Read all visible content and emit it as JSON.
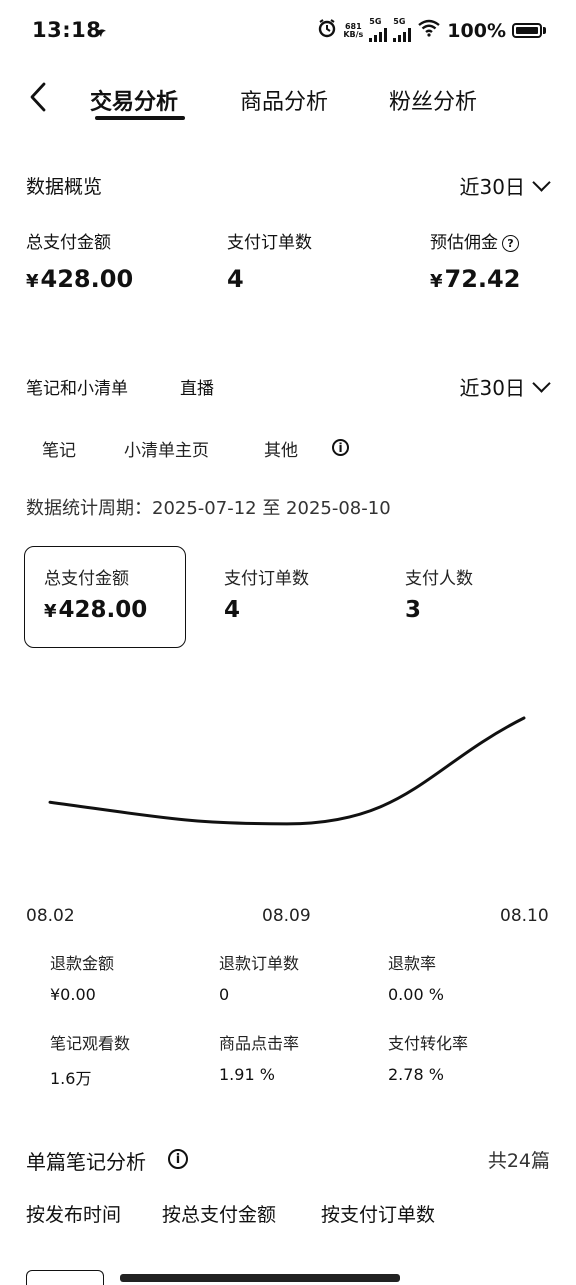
{
  "status_bar": {
    "time": "13:18",
    "net_speed_top": "681",
    "net_speed_bottom": "KB/s",
    "sig1": "5G",
    "sig2": "5G",
    "battery": "100%"
  },
  "nav": {
    "tabs": [
      {
        "label": "交易分析",
        "active": true
      },
      {
        "label": "商品分析",
        "active": false
      },
      {
        "label": "粉丝分析",
        "active": false
      }
    ]
  },
  "overview": {
    "title": "数据概览",
    "range": "近30日",
    "metrics": [
      {
        "label": "总支付金额",
        "currency": "¥",
        "value": "428.00"
      },
      {
        "label": "支付订单数",
        "value": "4"
      },
      {
        "label": "预估佣金",
        "currency": "¥",
        "value": "72.42",
        "help_icon": "?"
      }
    ]
  },
  "source": {
    "tabs": [
      "笔记和小清单",
      "直播"
    ],
    "range": "近30日",
    "subtabs": [
      "笔记",
      "小清单主页",
      "其他"
    ],
    "info_icon": "i",
    "period": "数据统计周期：2025-07-12 至 2025-08-10",
    "cards": [
      {
        "label": "总支付金额",
        "currency": "¥",
        "value": "428.00",
        "selected": true
      },
      {
        "label": "支付订单数",
        "value": "4"
      },
      {
        "label": "支付人数",
        "value": "3"
      }
    ]
  },
  "chart_data": {
    "type": "line",
    "x": [
      "08.02",
      "08.09",
      "08.10"
    ],
    "series": [
      {
        "values": [
          0.22,
          0.02,
          1.0
        ]
      }
    ],
    "ylim": [
      0,
      1
    ],
    "grid": false
  },
  "stats": [
    {
      "label": "退款金额",
      "value": "¥0.00"
    },
    {
      "label": "退款订单数",
      "value": "0"
    },
    {
      "label": "退款率",
      "value": "0.00 %"
    },
    {
      "label": "笔记观看数",
      "value": "1.6万"
    },
    {
      "label": "商品点击率",
      "value": "1.91 %"
    },
    {
      "label": "支付转化率",
      "value": "2.78 %"
    }
  ],
  "single_note": {
    "title": "单篇笔记分析",
    "info_icon": "i",
    "count": "共24篇",
    "sort_tabs": [
      "按发布时间",
      "按总支付金额",
      "按支付订单数"
    ]
  }
}
